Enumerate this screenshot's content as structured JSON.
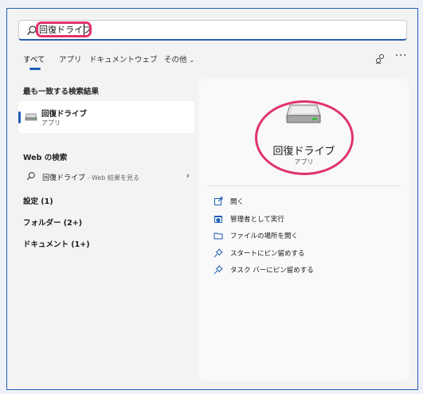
{
  "search": {
    "value": "回復ドライブ"
  },
  "tabs": [
    {
      "label": "すべて"
    },
    {
      "label": "アプリ"
    },
    {
      "label": "ドキュメント"
    },
    {
      "label": "ウェブ"
    },
    {
      "label": "その他"
    }
  ],
  "left": {
    "best_match_title": "最も一致する検索結果",
    "best_match": {
      "name": "回復ドライブ",
      "type": "アプリ"
    },
    "web_title": "Web の検索",
    "web_result": {
      "query": "回復ドライブ",
      "hint": " - Web 結果を見る"
    },
    "categories": [
      {
        "label": "設定 (1)"
      },
      {
        "label": "フォルダー (2+)"
      },
      {
        "label": "ドキュメント (1+)"
      }
    ]
  },
  "right": {
    "app_name": "回復ドライブ",
    "app_type": "アプリ",
    "actions": [
      {
        "label": "開く",
        "icon": "open-icon"
      },
      {
        "label": "管理者として実行",
        "icon": "shield-icon"
      },
      {
        "label": "ファイルの場所を開く",
        "icon": "folder-icon"
      },
      {
        "label": "スタートにピン留めする",
        "icon": "pin-icon"
      },
      {
        "label": "タスク バーにピン留めする",
        "icon": "pin-icon"
      }
    ]
  },
  "colors": {
    "accent": "#1f5fb8",
    "highlight": "#e1336c",
    "pane": "#f9f9f9",
    "window": "#f3f3f3"
  }
}
